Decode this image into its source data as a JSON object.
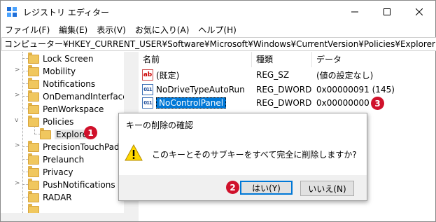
{
  "window": {
    "title": "レジストリ エディター"
  },
  "menu": [
    "ファイル(F)",
    "編集(E)",
    "表示(V)",
    "お気に入り(A)",
    "ヘルプ(H)"
  ],
  "address": "コンピューター¥HKEY_CURRENT_USER¥Software¥Microsoft¥Windows¥CurrentVersion¥Policies¥Explorer",
  "tree": [
    {
      "label": "Lock Screen"
    },
    {
      "label": "Mobility"
    },
    {
      "label": "Notifications"
    },
    {
      "label": "OnDemandInterfaceC"
    },
    {
      "label": "PenWorkspace"
    },
    {
      "label": "Policies"
    },
    {
      "label": "Explorer"
    },
    {
      "label": "PrecisionTouchPad"
    },
    {
      "label": "Prelaunch"
    },
    {
      "label": "Privacy"
    },
    {
      "label": "PushNotifications"
    },
    {
      "label": "RADAR"
    }
  ],
  "list": {
    "headers": [
      "名前",
      "種類",
      "データ"
    ],
    "rows": [
      {
        "name": "(既定)",
        "type": "REG_SZ",
        "data": "(値の設定なし)",
        "icon": "string-value-icon"
      },
      {
        "name": "NoDriveTypeAutoRun",
        "type": "REG_DWORD",
        "data": "0x00000091 (145)",
        "icon": "binary-value-icon"
      },
      {
        "name": "NoControlPanel",
        "type": "REG_DWORD",
        "data": "0x00000000 (0)",
        "icon": "binary-value-icon"
      }
    ]
  },
  "dialog": {
    "title": "キーの削除の確認",
    "message": "このキーとそのサブキーをすべて完全に削除しますか?",
    "yes": "はい(Y)",
    "no": "いいえ(N)"
  },
  "badges": [
    "1",
    "2",
    "3"
  ],
  "colors": {
    "selection": "#0078d7",
    "badge": "#d0112b",
    "folder": "#f0c75e"
  }
}
